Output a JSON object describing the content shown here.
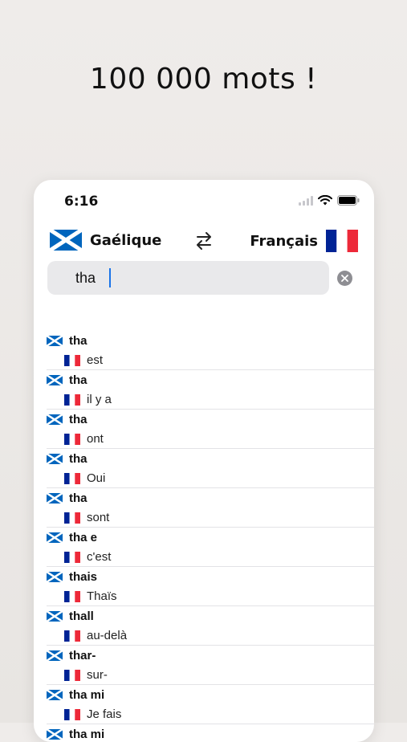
{
  "headline": "100 000 mots !",
  "status_bar": {
    "time": "6:16"
  },
  "languages": {
    "source": "Gaélique",
    "target": "Français"
  },
  "search": {
    "value": "tha"
  },
  "results": [
    {
      "source": "tha",
      "target": "est"
    },
    {
      "source": "tha",
      "target": "il y a"
    },
    {
      "source": "tha",
      "target": "ont"
    },
    {
      "source": "tha",
      "target": "Oui"
    },
    {
      "source": "tha",
      "target": "sont"
    },
    {
      "source": "tha e",
      "target": "c'est"
    },
    {
      "source": "thais",
      "target": "Thaïs"
    },
    {
      "source": "thall",
      "target": "au-delà"
    },
    {
      "source": "thar-",
      "target": "sur-"
    },
    {
      "source": "tha mi",
      "target": "Je fais"
    },
    {
      "source": "tha mi",
      "target": ""
    }
  ],
  "colors": {
    "scotland_blue": "#0065bd",
    "france_blue": "#002395",
    "france_red": "#ed2939",
    "caret": "#1a73e8"
  },
  "icons": [
    "scotland-flag-icon",
    "france-flag-icon",
    "swap-arrows-icon",
    "clear-icon",
    "wifi-icon",
    "battery-icon",
    "signal-icon"
  ]
}
